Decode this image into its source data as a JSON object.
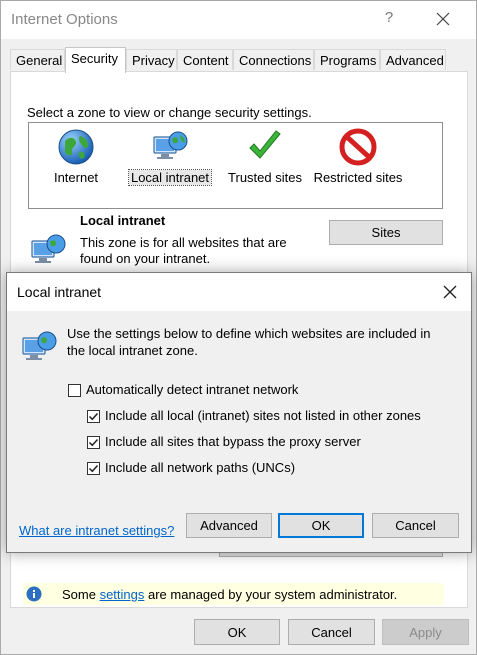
{
  "window": {
    "title": "Internet Options",
    "help_glyph": "?",
    "close_glyph": "✕"
  },
  "tabs": [
    {
      "label": "General"
    },
    {
      "label": "Security"
    },
    {
      "label": "Privacy"
    },
    {
      "label": "Content"
    },
    {
      "label": "Connections"
    },
    {
      "label": "Programs"
    },
    {
      "label": "Advanced"
    }
  ],
  "security": {
    "zone_prompt": "Select a zone to view or change security settings.",
    "zones": [
      {
        "label": "Internet",
        "icon": "globe-icon"
      },
      {
        "label": "Local intranet",
        "icon": "intranet-icon"
      },
      {
        "label": "Trusted sites",
        "icon": "checkmark-icon"
      },
      {
        "label": "Restricted sites",
        "icon": "no-entry-icon"
      }
    ],
    "selected_zone": "Local intranet",
    "zone_heading": "Local intranet",
    "zone_desc_line1": "This zone is for all websites that are",
    "zone_desc_line2": "found on your intranet.",
    "sites_button": "Sites"
  },
  "dialog": {
    "title": "Local intranet",
    "close_glyph": "✕",
    "desc_line1": "Use the settings below to define which websites are included in",
    "desc_line2": "the local intranet zone.",
    "options": [
      {
        "label": "Automatically detect intranet network",
        "checked": false
      },
      {
        "label": "Include all local (intranet) sites not listed in other zones",
        "checked": true
      },
      {
        "label": "Include all sites that bypass the proxy server",
        "checked": true
      },
      {
        "label": "Include all network paths (UNCs)",
        "checked": true
      }
    ],
    "help_link": "What are intranet settings?",
    "advanced_button": "Advanced",
    "ok_button": "OK",
    "cancel_button": "Cancel"
  },
  "info_bar": {
    "text_before": "Some ",
    "link_text": "settings",
    "text_after": " are managed by your system administrator.",
    "icon": "info-icon"
  },
  "footer": {
    "ok": "OK",
    "cancel": "Cancel",
    "apply": "Apply"
  },
  "colors": {
    "accent": "#0078d7",
    "link": "#0066cc",
    "info_bar_bg": "#ffffe1"
  }
}
